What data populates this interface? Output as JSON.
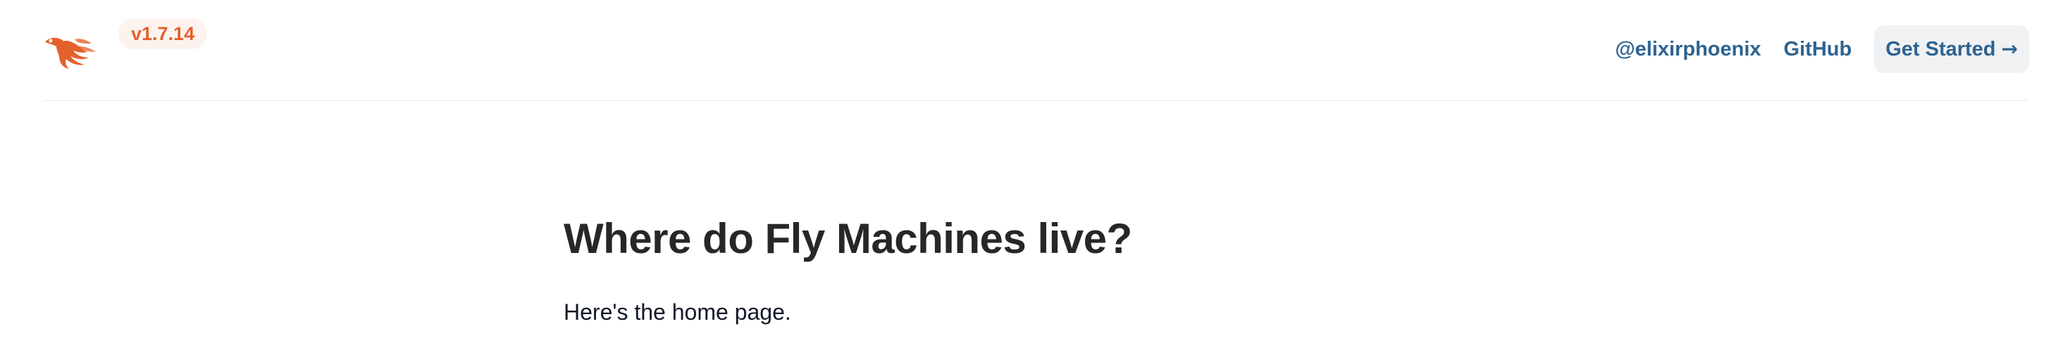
{
  "header": {
    "logo_icon": "phoenix-bird-icon",
    "brand_color": "#e4612b",
    "version": "v1.7.14",
    "nav": {
      "twitter_label": "@elixirphoenix",
      "github_label": "GitHub",
      "get_started_label": "Get Started",
      "get_started_arrow": "→"
    },
    "link_color": "#2d6391"
  },
  "main": {
    "title": "Where do Fly Machines live?",
    "intro": "Here's the home page."
  }
}
